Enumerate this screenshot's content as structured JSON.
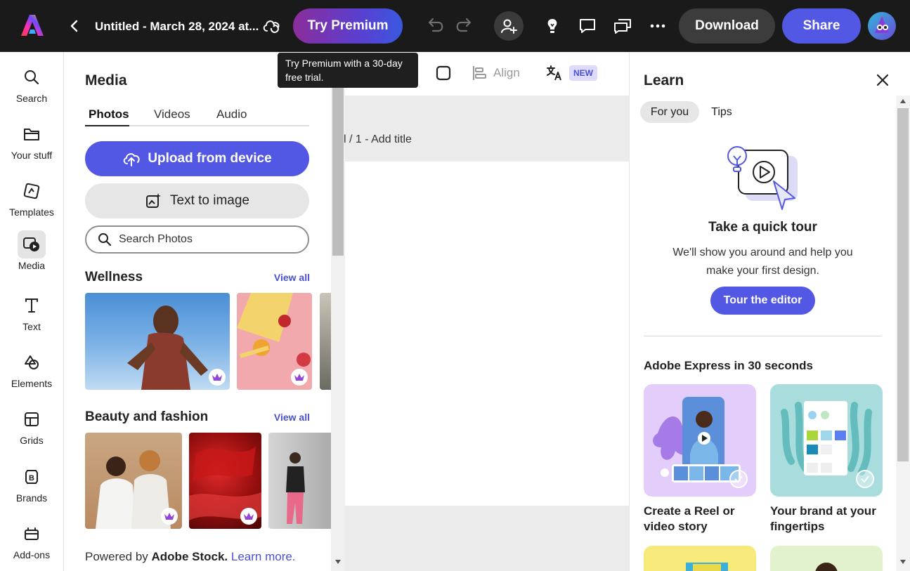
{
  "topbar": {
    "doc_title": "Untitled - March 28, 2024 at...",
    "try_premium": "Try Premium",
    "download": "Download",
    "share": "Share"
  },
  "tooltip": {
    "text": "Try Premium with a 30-day free trial."
  },
  "rail": {
    "items": [
      {
        "label": "Search",
        "icon": "search-icon"
      },
      {
        "label": "Your stuff",
        "icon": "folder-icon"
      },
      {
        "label": "Templates",
        "icon": "templates-icon"
      },
      {
        "label": "Media",
        "icon": "media-icon"
      },
      {
        "label": "Text",
        "icon": "text-icon"
      },
      {
        "label": "Elements",
        "icon": "elements-icon"
      },
      {
        "label": "Grids",
        "icon": "grids-icon"
      },
      {
        "label": "Brands",
        "icon": "brands-icon"
      },
      {
        "label": "Add-ons",
        "icon": "addons-icon"
      }
    ],
    "active": "Media"
  },
  "media": {
    "title": "Media",
    "tabs": [
      {
        "label": "Photos"
      },
      {
        "label": "Videos"
      },
      {
        "label": "Audio"
      }
    ],
    "upload": "Upload from device",
    "text_to_image": "Text to image",
    "search_placeholder": "Search Photos",
    "sections": [
      {
        "title": "Wellness",
        "view_all": "View all"
      },
      {
        "title": "Beauty and fashion",
        "view_all": "View all"
      }
    ],
    "powered_prefix": "Powered by",
    "powered_brand": "Adobe Stock.",
    "learn_more": "Learn more."
  },
  "canvas": {
    "align": "Align",
    "new_badge": "NEW",
    "page_label": "l / 1 - Add title"
  },
  "learn": {
    "title": "Learn",
    "tabs": [
      {
        "label": "For you"
      },
      {
        "label": "Tips"
      }
    ],
    "tour_title": "Take a quick tour",
    "tour_desc": "We'll show you around and help you make your first design.",
    "tour_button": "Tour the editor",
    "video_section": "Adobe Express in 30 seconds",
    "cards": [
      {
        "label": "Create a Reel or video story"
      },
      {
        "label": "Your brand at your fingertips"
      }
    ]
  },
  "colors": {
    "accent": "#5258e4",
    "topbar_bg": "#1a1a1a",
    "link": "#4a51d1"
  }
}
